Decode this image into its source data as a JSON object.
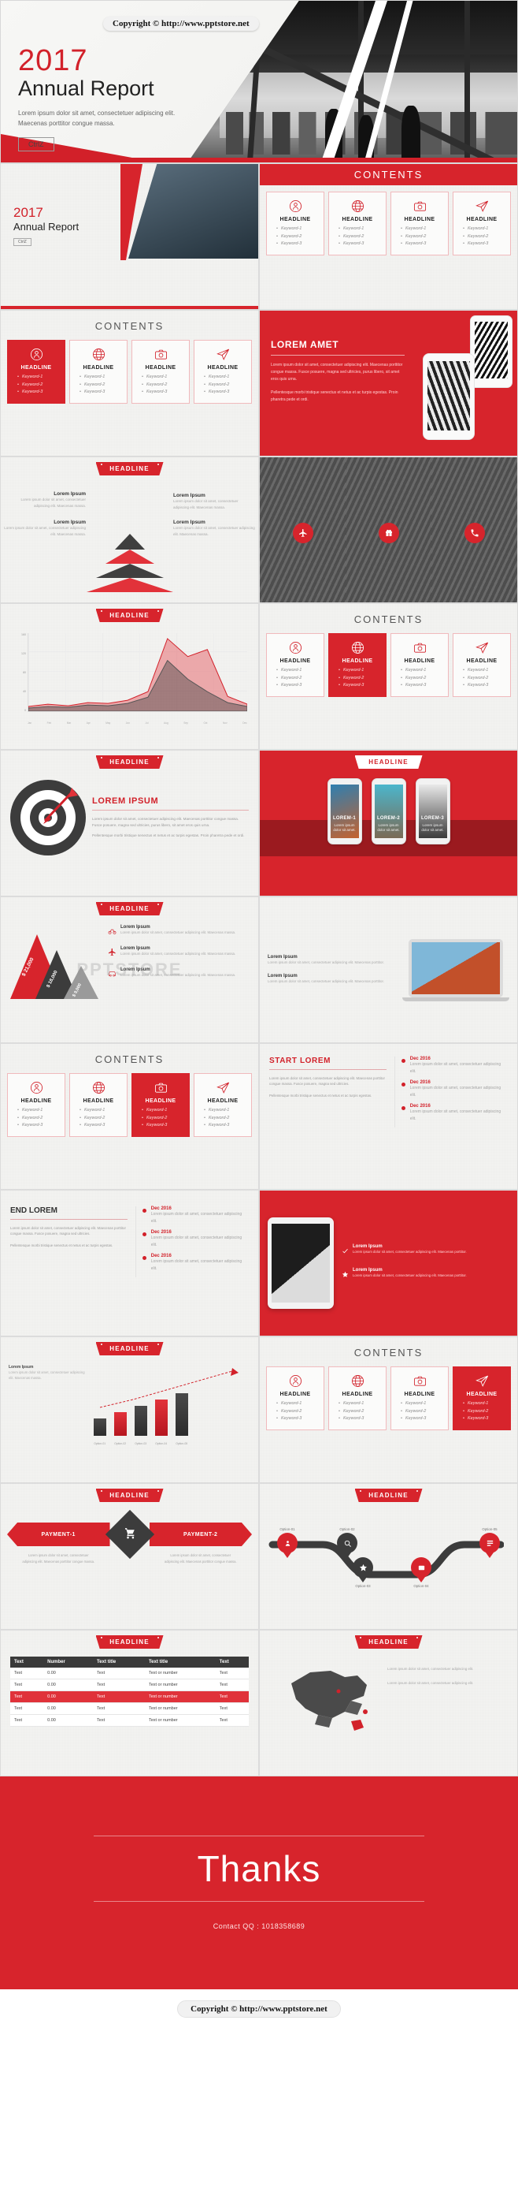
{
  "brand": {
    "red": "#d7242c",
    "dark": "#3c3c3c",
    "light": "#f4f4f2"
  },
  "copyright": {
    "text": "Copyright © http://www.pptstore.net"
  },
  "cover": {
    "year": "2017",
    "title": "Annual Report",
    "subtitle_line1": "Lorem ipsum dolor sit amet, consectetuer adipiscing elit.",
    "subtitle_line2": "Maecenas porttitor congue massa.",
    "button_label": "CtrlZ"
  },
  "slide_titles": {
    "contents": "CONTENTS",
    "headline": "HEADLINE",
    "lorem_amet": "LOREM AMET",
    "lorem_ipsum": "LOREM IPSUM",
    "start_lorem": "START LOREM",
    "end_lorem": "END LOREM"
  },
  "contents_cards": [
    {
      "icon": "person-icon",
      "headline": "HEADLINE",
      "keywords": [
        "Keyword-1",
        "Keyword-2",
        "Keyword-3"
      ]
    },
    {
      "icon": "globe-icon",
      "headline": "HEADLINE",
      "keywords": [
        "Keyword-1",
        "Keyword-2",
        "Keyword-3"
      ]
    },
    {
      "icon": "camera-icon",
      "headline": "HEADLINE",
      "keywords": [
        "Keyword-1",
        "Keyword-2",
        "Keyword-3"
      ]
    },
    {
      "icon": "paper-plane-icon",
      "headline": "HEADLINE",
      "keywords": [
        "Keyword-1",
        "Keyword-2",
        "Keyword-3"
      ]
    }
  ],
  "body_text": {
    "para1": "Lorem ipsum dolor sit amet, consectetuer adipiscing elit. Maecenas porttitor congue massa. Fusce posuere, magna sed ultricies, purus libero, sit amet eros quis urna.",
    "para2": "Pellentesque morbi tristique senectus et netus et ac turpis egestas. Proin pharetra pede et ordi.",
    "short": "Lorem ipsum dolor sit amet, consectetuer adipiscing elit. Maecenas massa.",
    "tiny": "Lorem ipsum dolor sit amet, consectetuer adipiscing elit. Maecenas porttitor congue massa."
  },
  "pyramid": {
    "labels": [
      "Lorem Ipsum",
      "Lorem Ipsum",
      "Lorem Ipsum",
      "Lorem Ipsum"
    ],
    "desc": "Lorem ipsum dolor sit amet, consectetuer adipiscing elit. Maecenas massa."
  },
  "chart_data": {
    "type": "area",
    "title": "HEADLINE",
    "x": [
      "Jan",
      "Feb",
      "Mar",
      "Apr",
      "May",
      "Jun",
      "Jul",
      "Aug",
      "Sep",
      "Oct",
      "Nov",
      "Dec"
    ],
    "categories": [
      "Jan",
      "Feb",
      "Mar",
      "Apr",
      "May",
      "Jun",
      "Jul",
      "Aug",
      "Sep",
      "Oct",
      "Nov",
      "Dec"
    ],
    "ytick_labels": [
      "160",
      "120",
      "80",
      "40",
      "0"
    ],
    "ylim": [
      0,
      160
    ],
    "grid": true,
    "legend_position": "none",
    "xlabel": "",
    "ylabel": "",
    "series": [
      {
        "name": "Series 1",
        "color": "#e8666e",
        "values": [
          10,
          14,
          12,
          18,
          16,
          22,
          40,
          148,
          112,
          126,
          30,
          14
        ]
      },
      {
        "name": "Series 2",
        "color": "#6b6b6b",
        "values": [
          6,
          9,
          8,
          12,
          11,
          15,
          28,
          104,
          66,
          40,
          18,
          9
        ]
      }
    ]
  },
  "pricing": {
    "values": [
      "$ 21,000",
      "$ 18,000",
      "$ 9,000"
    ],
    "items": [
      {
        "icon": "bike-icon",
        "title": "Lorem Ipsum",
        "desc": "Lorem ipsum dolor sit amet, consectetuer adipiscing elit. Maecenas massa."
      },
      {
        "icon": "plane-icon",
        "title": "Lorem Ipsum",
        "desc": "Lorem ipsum dolor sit amet, consectetuer adipiscing elit. Maecenas massa."
      },
      {
        "icon": "car-icon",
        "title": "Lorem Ipsum",
        "desc": "Lorem ipsum dolor sit amet, consectetuer adipiscing elit. Maecenas massa."
      }
    ]
  },
  "phones": [
    {
      "label": "LOREM-1",
      "caption": "Lorem ipsum dolor sit amet."
    },
    {
      "label": "LOREM-2",
      "caption": "Lorem ipsum dolor sit amet."
    },
    {
      "label": "LOREM-3",
      "caption": "Lorem ipsum dolor sit amet."
    }
  ],
  "timeline_start": {
    "title": "START LOREM",
    "intro": "Lorem ipsum dolor sit amet, consectetuer adipiscing elit. Maecenas porttitor congue massa. Fusce posuere, magna sed ultricies.",
    "intro2": "Pellentesque morbi tristique senectus et netus et ac turpis egestas.",
    "events": [
      {
        "date": "Dec 2016",
        "text": "Lorem ipsum dolor sit amet, consectetuer adipiscing elit."
      },
      {
        "date": "Dec 2016",
        "text": "Lorem ipsum dolor sit amet, consectetuer adipiscing elit."
      },
      {
        "date": "Dec 2016",
        "text": "Lorem ipsum dolor sit amet, consectetuer adipiscing elit."
      }
    ]
  },
  "timeline_end": {
    "title": "END LOREM",
    "events": [
      {
        "date": "Dec 2016",
        "text": "Lorem ipsum dolor sit amet, consectetuer adipiscing elit."
      },
      {
        "date": "Dec 2016",
        "text": "Lorem ipsum dolor sit amet, consectetuer adipiscing elit."
      },
      {
        "date": "Dec 2016",
        "text": "Lorem ipsum dolor sit amet, consectetuer adipiscing elit."
      }
    ]
  },
  "tablet_slide": {
    "items": [
      {
        "title": "Lorem Ipsum",
        "desc": "Lorem ipsum dolor sit amet, consectetuer adipiscing elit. Maecenas porttitor."
      },
      {
        "title": "Lorem Ipsum",
        "desc": "Lorem ipsum dolor sit amet, consectetuer adipiscing elit. Maecenas porttitor."
      }
    ]
  },
  "payment": {
    "left_label": "PAYMENT-1",
    "right_label": "PAYMENT-2",
    "left_desc": "Lorem ipsum dolor sit amet, consectetuer adipiscing elit. Maecenas porttitor congue massa.",
    "right_desc": "Lorem ipsum dolor sit amet, consectetuer adipiscing elit. Maecenas porttitor congue massa.",
    "center_icon": "shopping-cart-icon"
  },
  "process": {
    "top_labels": [
      "Option-01",
      "Option-02",
      "Option-05"
    ],
    "bottom_labels": [
      "Option-03",
      "Option-04"
    ]
  },
  "table": {
    "headers": [
      "Text",
      "Number",
      "Text title",
      "Text title",
      "Text"
    ],
    "rows": [
      [
        "Text",
        "0.00",
        "Text",
        "Text or number",
        "Text"
      ],
      [
        "Text",
        "0.00",
        "Text",
        "Text or number",
        "Text"
      ],
      [
        "Text",
        "0.00",
        "Text",
        "Text or number",
        "Text"
      ],
      [
        "Text",
        "0.00",
        "Text",
        "Text or number",
        "Text"
      ],
      [
        "Text",
        "0.00",
        "Text",
        "Text or number",
        "Text"
      ]
    ],
    "highlight_row_index": 2
  },
  "map_slide": {
    "desc1": "Lorem ipsum dolor sit amet, consectetuer adipiscing elit.",
    "desc2": "Lorem ipsum dolor sit amet, consectetuer adipiscing elit."
  },
  "thanks": {
    "title": "Thanks",
    "contact": "Contact QQ : 1018358689"
  }
}
